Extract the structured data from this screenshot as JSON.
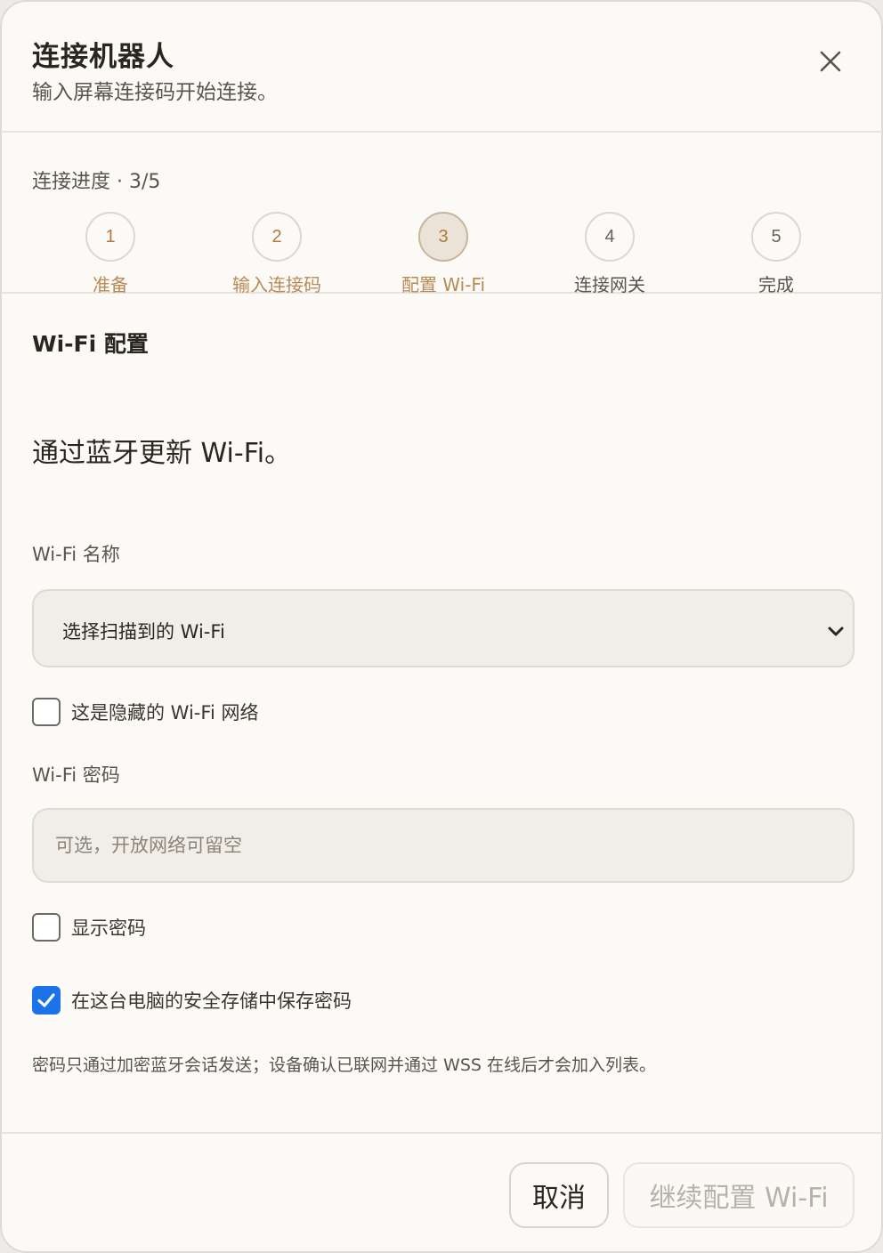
{
  "dialog": {
    "title": "连接机器人",
    "subtitle": "输入屏幕连接码开始连接。",
    "close_icon": "close-icon"
  },
  "progress": {
    "label": "连接进度 · 3/5",
    "steps": [
      {
        "number": "1",
        "label": "准备",
        "state": "done"
      },
      {
        "number": "2",
        "label": "输入连接码",
        "state": "done"
      },
      {
        "number": "3",
        "label": "配置 Wi-Fi",
        "state": "current"
      },
      {
        "number": "4",
        "label": "连接网关",
        "state": "pending"
      },
      {
        "number": "5",
        "label": "完成",
        "state": "pending"
      }
    ]
  },
  "wifi": {
    "section_title": "Wi-Fi 配置",
    "lead": "通过蓝牙更新 Wi-Fi。",
    "name_label": "Wi-Fi 名称",
    "select_value": "选择扫描到的 Wi-Fi",
    "hidden_network_label": "这是隐藏的 Wi-Fi 网络",
    "hidden_network_checked": false,
    "password_label": "Wi-Fi 密码",
    "password_placeholder": "可选，开放网络可留空",
    "password_value": "",
    "show_password_label": "显示密码",
    "show_password_checked": false,
    "save_password_label": "在这台电脑的安全存储中保存密码",
    "save_password_checked": true,
    "note": "密码只通过加密蓝牙会话发送；设备确认已联网并通过 WSS 在线后才会加入列表。"
  },
  "footer": {
    "cancel_label": "取消",
    "continue_label": "继续配置 Wi-Fi",
    "continue_disabled": true
  },
  "colors": {
    "accent_step": "#b07a3e",
    "checkbox_checked": "#1a73e8",
    "background": "#fbfaf6"
  }
}
